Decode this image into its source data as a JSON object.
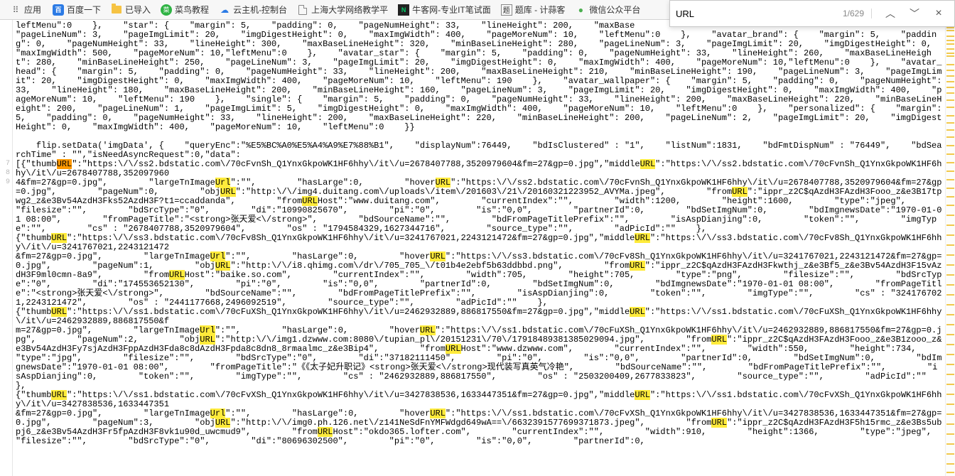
{
  "bookmarks": {
    "apps": "应用",
    "items": [
      {
        "icon": "baidu",
        "label": "百度一下"
      },
      {
        "icon": "folder",
        "label": "已导入"
      },
      {
        "icon": "caoniao",
        "label": "菜鸟教程"
      },
      {
        "icon": "cloud",
        "label": "云主机-控制台"
      },
      {
        "icon": "page",
        "label": "上海大学网络教学平"
      },
      {
        "icon": "niuke",
        "label": "牛客网-专业IT笔试面"
      },
      {
        "icon": "tiku",
        "label": "题库 - 计蒜客"
      },
      {
        "icon": "wechat",
        "label": "微信公众平台"
      }
    ]
  },
  "findbar": {
    "query": "URL",
    "count_text": "1/629"
  },
  "gutter": [
    "7",
    "8",
    "9"
  ],
  "code_pre": "leftMenu\":0    },    \"star\": {    \"margin\": 5,    \"padding\": 0,    \"pageNumHeight\": 33,    \"lineHeight\": 200,    \"maxBase\n\"pageLineNum\": 3,    \"pageImgLimit\": 20,    \"imgDigestHeight\": 0,    \"maxImgWidth\": 400,    \"pageMoreNum\": 10,    \"leftMenu\":0    },    \"avatar_brand\": {    \"margin\": 5,    \"padding\": 0,    \"pageNumHeight\": 33,    \"lineHeight\": 300,    \"maxBaseLineHeight\": 320,    \"minBaseLineHeight\": 280,    \"pageLineNum\": 3,    \"pageImgLimit\": 20,    \"imgDigestHeight\": 0,    \"maxImgWidth\": 500,    \"pageMoreNum\": 10,\"leftMenu\":0    },    \"avatar_star\": {    \"margin\": 5,    \"padding\": 0,    \"pageNumHeight\": 33,    \"lineHeight\": 260,    \"maxBaseLineHeight\": 280,    \"minBaseLineHeight\": 250,    \"pageLineNum\": 3,    \"pageImgLimit\": 20,    \"imgDigestHeight\": 0,    \"maxImgWidth\": 400,    \"pageMoreNum\": 10,\"leftMenu\":0    },    \"avatar_head\": {    \"margin\": 5,    \"padding\": 0,    \"pageNumHeight\": 33,    \"lineHeight\": 200,    \"maxBaseLineHeight\": 210,    \"minBaseLineHeight\": 190,    \"pageLineNum\": 3,    \"pageImgLimit\": 20,    \"imgDigestHeight\": 0,    \"maxImgWidth\": 400,    \"pageMoreNum\": 10,    \"leftMenu\": 190    },    \"avatar_wallpaper\": {    \"margin\": 5,    \"padding\": 0,    \"pageNumHeight\": 33,    \"lineHeight\": 180,    \"maxBaseLineHeight\": 200,    \"minBaseLineHeight\": 160,    \"pageLineNum\": 3,    \"pageImgLimit\": 20,    \"imgDigestHeight\": 0,    \"maxImgWidth\": 400,    \"pageMoreNum\": 10,    \"leftMenu\": 190    },    \"single\": {    \"margin\": 5,    \"padding\": 0,    \"pageNumHeight\": 33,    \"lineHeight\": 200,    \"maxBaseLineHeight\": 220,    \"minBaseLineHeight\": 200,    \"pageLineNum\": 1,    \"pageImgLimit\": 5,    \"imgDigestHeight\": 0,    \"maxImgWidth\": 400,    \"pageMoreNum\": 10,    \"leftMenu\":0    },    \"personalized\": {    \"margin\": 5,    \"padding\": 0,    \"pageNumHeight\": 33,    \"lineHeight\": 200,    \"maxBaseLineHeight\": 220,    \"minBaseLineHeight\": 200,    \"pageLineNum\": 2,    \"pageImgLimit\": 20,    \"imgDigestHeight\": 0,    \"maxImgWidth\": 400,    \"pageMoreNum\": 10,    \"leftMenu\":0    }}\n\n    flip.setData('imgData', {    \"queryEnc\":\"%E5%BC%A0%E5%A4%A9%E7%88%B1\",    \"displayNum\":76449,    \"bdIsClustered\" : \"1\",    \"listNum\":1831,    \"bdFmtDispNum\" : \"76449\",    \"bdSearchTime\" : \"\",\"isNeedAsyncRequest\":0,\"data\":\n[{\"thumb",
  "code_post": "\":\"https:\\/\\/ss2.bdstatic.com\\/70cFvnSh_Q1YnxGkpoWK1HF6hhy\\/it\\/u=2678407788,3520979604&fm=27&gp=0.jpg\",\"middleURL\":\"https:\\/\\/ss2.bdstatic.com\\/70cFvnSh_Q1YnxGkpoWK1HF6hhy\\/it\\/u=2678407788,352097960\n4&fm=27&gp=0.jpg\",        \"largeTnImageUrl\":\"\",        \"hasLarge\":0,        \"hoverURL\":\"https:\\/\\/ss2.bdstatic.com\\/70cFvnSh_Q1YnxGkpoWK1HF6hhy\\/it\\/u=2678407788,3520979604&fm=27&gp=0.jpg\",        \"pageNum\":0,        \"objURL\":\"http:\\/\\/img4.duitang.com\\/uploads\\/item\\/201603\\/21\\/20160321223952_AVYMa.jpeg\",        \"fromURL\":\"ippr_z2C$qAzdH3FAzdH3Fooo_z&e3B17tpwg2_z&e3Bv54AzdH3Fks52AzdH3F?t1=ccaddanda\",        \"fromURLHost\":\"www.duitang.com\",        \"currentIndex\":\"\",        \"width\":1200,        \"height\":1600,        \"type\":\"jpeg\",        \"filesize\":\"\",        \"bdSrcType\":\"0\",        \"di\":\"10990825670\",        \"pi\":\"0\",        \"is\":\"0,0\",        \"partnerId\":0,        \"bdSetImgNum\":0,        \"bdImgnewsDate\":\"1970-01-01 08:00\",        \"fromPageTitle\":\"<strong>张天爱<\\/strong>\",        \"bdSourceName\":\"\",        \"bdFromPageTitlePrefix\":\"\",        \"isAspDianjing\":0,        \"token\":\"\",        \"imgType\":\"\",        \"cs\" : \"2678407788,3520979604\",        \"os\" : \"1794584329,1627344716\",        \"source_type\":\"\",        \"adPicId\":\"\"    },\n{\"thumbURL\":\"https:\\/\\/ss3.bdstatic.com\\/70cFv8Sh_Q1YnxGkpoWK1HF6hhy\\/it\\/u=3241767021,2243121472&fm=27&gp=0.jpg\",\"middleURL\":\"https:\\/\\/ss3.bdstatic.com\\/70cFv8Sh_Q1YnxGkpoWK1HF6hhy\\/it\\/u=3241767021,2243121472\n&fm=27&gp=0.jpg\",        \"largeTnImageUrl\":\"\",        \"hasLarge\":0,        \"hoverURL\":\"https:\\/\\/ss3.bdstatic.com\\/70cFv8Sh_Q1YnxGkpoWK1HF6hhy\\/it\\/u=3241767021,2243121472&fm=27&gp=0.jpg\",        \"pageNum\":1,        \"objURL\":\"http:\\/\\/i8.qhimg.com\\/dr\\/705_705_\\/t01b4e2ebf5b63ddbbd.png\",        \"fromURL\":\"ippr_z2C$qAzdH3FAzdH3Fkwthj_z&e3Bf5_z&e3Bv54AzdH3F15vAzdH3F9ml0cmn-8a9\",        \"fromURLHost\":\"baike.so.com\",        \"currentIndex\":\"\",        \"width\":705,        \"height\":705,        \"type\":\"png\",        \"filesize\":\"\",        \"bdSrcType\":\"0\",        \"di\":\"174553652130\",        \"pi\":\"0\",        \"is\":\"0,0\",        \"partnerId\":0,        \"bdSetImgNum\":0,        \"bdImgnewsDate\":\"1970-01-01 08:00\",        \"fromPageTitle\":\"<strong>张天爱<\\/strong>\",        \"bdSourceName\":\"\",        \"bdFromPageTitlePrefix\":\"\",        \"isAspDianjing\":0,        \"token\":\"\",        \"imgType\":\"\",        \"cs\" : \"3241767021,2243121472\",        \"os\" : \"2441177668,2496092519\",        \"source_type\":\"\",        \"adPicId\":\"\"    },\n{\"thumbURL\":\"https:\\/\\/ss1.bdstatic.com\\/70cFuXSh_Q1YnxGkpoWK1HF6hhy\\/it\\/u=2462932889,886817550&fm=27&gp=0.jpg\",\"middleURL\":\"https:\\/\\/ss1.bdstatic.com\\/70cFuXSh_Q1YnxGkpoWK1HF6hhy\\/it\\/u=2462932889,886817550&f\nm=27&gp=0.jpg\",        \"largeTnImageUrl\":\"\",        \"hasLarge\":0,        \"hoverURL\":\"https:\\/\\/ss1.bdstatic.com\\/70cFuXSh_Q1YnxGkpoWK1HF6hhy\\/it\\/u=2462932889,886817550&fm=27&gp=0.jpg\",        \"pageNum\":2,        \"objURL\":\"http:\\/\\/img1.dzwww.com:8080\\/tupian_pl\\/20151231\\/70\\/17918489381385029094.jpg\",        \"fromURL\":\"ippr_z2C$qAzdH3FAzdH3Fooo_z&e3B1zooo_z&e3Bv54AzdH3Fy7sjAzdH3FppAzdH3Fda8c8dAzdH3Fpda8c8dn8_8rmaalmc_z&e3Bip4\",        \"fromURLHost\":\"www.dzwww.com\",        \"currentIndex\":\"\",        \"width\":550,        \"height\":734,        \"type\":\"jpg\",        \"filesize\":\"\",        \"bdSrcType\":\"0\",        \"di\":\"37182111450\",        \"pi\":\"0\",        \"is\":\"0,0\",        \"partnerId\":0,        \"bdSetImgNum\":0,        \"bdImgnewsDate\":\"1970-01-01 08:00\",        \"fromPageTitle\":\"《《太子妃升职记》<strong>张天爱<\\/strong>现代装写真英气冷艳\",        \"bdSourceName\":\"\",        \"bdFromPageTitlePrefix\":\"\",        \"isAspDianjing\":0,        \"token\":\"\",        \"imgType\":\"\",        \"cs\" : \"2462932889,886817550\",        \"os\" : \"2503200409,2677833823\",        \"source_type\":\"\",        \"adPicId\":\"\"    },\n{\"thumbURL\":\"https:\\/\\/ss1.bdstatic.com\\/70cFvXSh_Q1YnxGkpoWK1HF6hhy\\/it\\/u=3427838536,1633447351&fm=27&gp=0.jpg\",\"middleURL\":\"https:\\/\\/ss1.bdstatic.com\\/70cFvXSh_Q1YnxGkpoWK1HF6hhy\\/it\\/u=3427838536,1633447351\n&fm=27&gp=0.jpg\",        \"largeTnImageUrl\":\"\",        \"hasLarge\":0,        \"hoverURL\":\"https:\\/\\/ss1.bdstatic.com\\/70cFvXSh_Q1YnxGkpoWK1HF6hhy\\/it\\/u=3427838536,1633447351&fm=27&gp=0.jpg\",        \"pageNum\":3,        \"objURL\":\"http:\\/\\/img0.ph.126.net\\/z141NeSdFnYMFWdgd649wA==\\/6632391577699371873.jpeg\",        \"fromURL\":\"ippr_z2C$qAzdH3FAzdH3F5h15rmc_z&e3Bs5ubpj6_z&e3Bv54AzdH3Fr5fpAzdH3F8vk1u90d_uwcmud9\",        \"fromURLHost\":\"okdo365.lofter.com\",        \"currentIndex\":\"\",        \"width\":910,        \"height\":1366,        \"type\":\"jpeg\",        \"filesize\":\"\",        \"bdSrcType\":\"0\",        \"di\":\"80696302500\",        \"pi\":\"0\",        \"is\":\"0,0\",        \"partnerId\":0,        ",
  "minimap_marks": [
    2,
    6,
    10,
    14,
    22,
    28,
    33,
    40,
    46,
    50,
    62,
    70,
    78,
    86,
    94,
    102,
    112,
    122,
    134,
    144,
    154,
    164,
    176,
    188,
    200,
    212,
    224,
    236,
    248,
    260,
    274,
    288,
    302,
    316,
    330,
    344,
    358,
    372,
    386,
    400,
    414,
    428,
    442,
    456,
    470,
    484,
    498,
    512,
    526,
    540,
    554,
    568,
    582,
    596,
    610,
    624,
    636
  ]
}
